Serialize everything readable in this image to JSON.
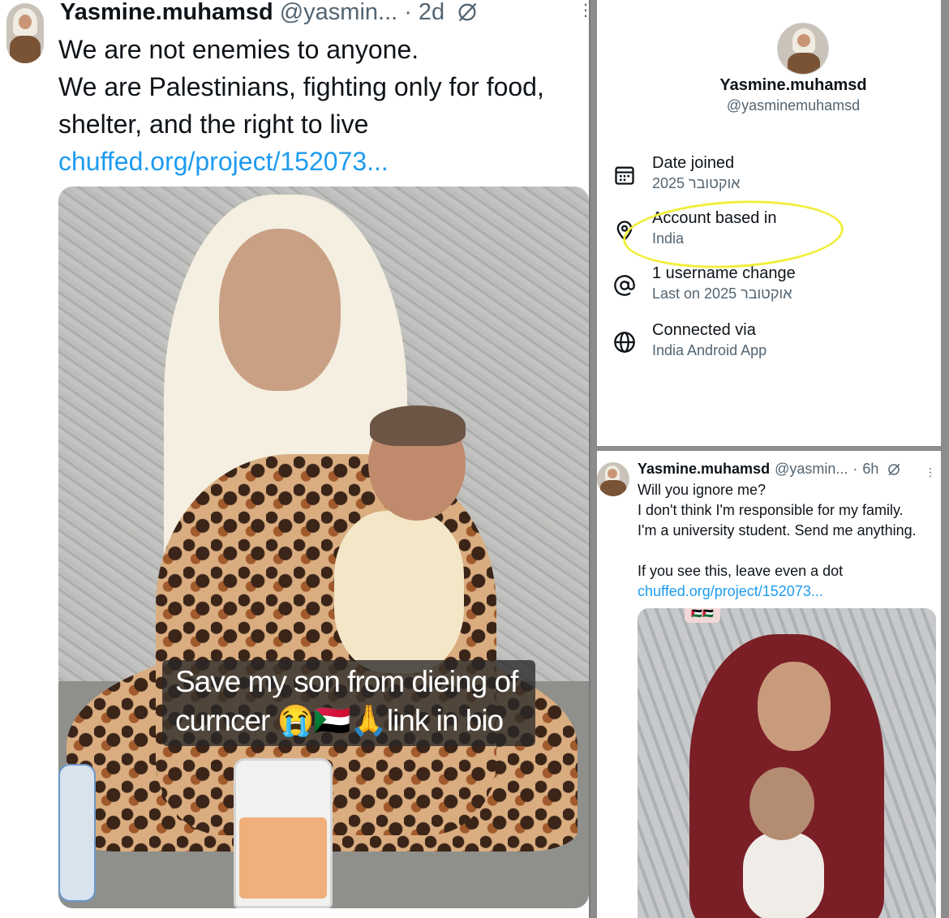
{
  "left_tweet": {
    "display_name": "Yasmine.muhamsd",
    "handle": "@yasmin...",
    "separator": "·",
    "time": "2d",
    "text_lines": [
      "We are not enemies to anyone.",
      "We are Palestinians, fighting only for food,",
      "shelter, and the right to live"
    ],
    "link": "chuffed.org/project/152073...",
    "media_caption_lines": [
      "Save my son from dieing of",
      "curncer 😭🇸🇩🙏link in bio"
    ]
  },
  "about_panel": {
    "display_name": "Yasmine.muhamsd",
    "handle": "@yasminemuhamsd",
    "rows": [
      {
        "icon": "calendar-icon",
        "label": "Date joined",
        "value": "אוקטובר 2025"
      },
      {
        "icon": "location-pin-icon",
        "label": "Account based in",
        "value": "India"
      },
      {
        "icon": "at-sign-icon",
        "label": "1 username change",
        "value": "Last on אוקטובר 2025"
      },
      {
        "icon": "globe-icon",
        "label": "Connected via",
        "value": "India Android App"
      }
    ],
    "highlight_color": "#f2ee3a"
  },
  "right_tweet": {
    "display_name": "Yasmine.muhamsd",
    "handle": "@yasmin...",
    "separator": "·",
    "time": "6h",
    "text_lines": [
      "Will you ignore me?",
      "I don't think I'm responsible for my family.",
      "I'm a university student. Send me anything.",
      "",
      "If you see this, leave even a dot"
    ],
    "link": "chuffed.org/project/152073...",
    "media_badge": "🇵🇸🇵🇸"
  },
  "colors": {
    "text_primary": "#0f1419",
    "text_secondary": "#536471",
    "link": "#1d9bf0"
  }
}
